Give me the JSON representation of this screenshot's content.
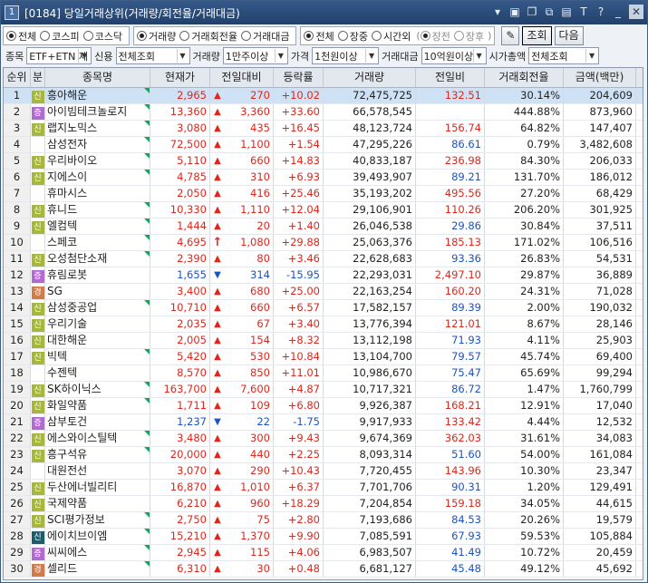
{
  "window": {
    "number": "1",
    "title": "[0184] 당일거래상위(거래량/회전율/거래대금)"
  },
  "titlebar_icons": [
    "menu-icon",
    "layout-icon",
    "copy-icon",
    "link-icon",
    "print-icon",
    "font-icon",
    "help-icon"
  ],
  "filters": {
    "market": {
      "options": [
        "전체",
        "코스피",
        "코스닥"
      ],
      "selected": 0
    },
    "sort": {
      "options": [
        "거래량",
        "거래회전율",
        "거래대금"
      ],
      "selected": 0
    },
    "session": {
      "options": [
        "전체",
        "장중",
        "시간외"
      ],
      "selected": 0
    },
    "session_sub": {
      "options": [
        "장전",
        "장후"
      ],
      "selected": 0
    },
    "query_btn": "조회",
    "next_btn": "다음",
    "stock_label": "종목",
    "stock_value": "ETF+ETN 제",
    "credit_label": "신용",
    "credit_value": "전체조회",
    "volume_label": "거래량",
    "volume_value": "1만주이상",
    "price_label": "가격",
    "price_value": "1천원이상",
    "amount_label": "거래대금",
    "amount_value": "10억원이상",
    "mcap_label": "시가총액",
    "mcap_value": "전체조회"
  },
  "columns": [
    "순위",
    "분",
    "종목명",
    "현재가",
    "전일대비",
    "등락률",
    "거래량",
    "전일비",
    "거래회전율",
    "금액(백만)"
  ],
  "colors": {
    "up": "#e0251b",
    "down": "#1a53c6",
    "accent": "#22406a"
  },
  "rows": [
    {
      "rank": "1",
      "badge": "신",
      "name": "흥아해운",
      "price": "2,965",
      "dir": "up",
      "change": "270",
      "rate": "+10.02",
      "volume": "72,475,725",
      "prev": "132.51",
      "turnover": "30.14%",
      "amount": "204,609"
    },
    {
      "rank": "2",
      "badge": "증",
      "name": "아이빔테크놀로지",
      "price": "13,360",
      "dir": "up",
      "change": "3,360",
      "rate": "+33.60",
      "volume": "66,578,545",
      "prev": "",
      "turnover": "444.88%",
      "amount": "873,960"
    },
    {
      "rank": "3",
      "badge": "신",
      "name": "랩지노믹스",
      "price": "3,080",
      "dir": "up",
      "change": "435",
      "rate": "+16.45",
      "volume": "48,123,724",
      "prev": "156.74",
      "turnover": "64.82%",
      "amount": "147,407"
    },
    {
      "rank": "4",
      "badge": "",
      "name": "삼성전자",
      "price": "72,500",
      "dir": "up",
      "change": "1,100",
      "rate": "+1.54",
      "volume": "47,295,226",
      "prev": "86.61",
      "turnover": "0.79%",
      "amount": "3,482,608"
    },
    {
      "rank": "5",
      "badge": "신",
      "name": "우리바이오",
      "price": "5,110",
      "dir": "up",
      "change": "660",
      "rate": "+14.83",
      "volume": "40,833,187",
      "prev": "236.98",
      "turnover": "84.30%",
      "amount": "206,033"
    },
    {
      "rank": "6",
      "badge": "신",
      "name": "지에스이",
      "price": "4,785",
      "dir": "up",
      "change": "310",
      "rate": "+6.93",
      "volume": "39,493,907",
      "prev": "89.21",
      "turnover": "131.70%",
      "amount": "186,012"
    },
    {
      "rank": "7",
      "badge": "",
      "name": "휴마시스",
      "price": "2,050",
      "dir": "up",
      "change": "416",
      "rate": "+25.46",
      "volume": "35,193,202",
      "prev": "495.56",
      "turnover": "27.20%",
      "amount": "68,429"
    },
    {
      "rank": "8",
      "badge": "신",
      "name": "휴니드",
      "price": "10,330",
      "dir": "up",
      "change": "1,110",
      "rate": "+12.04",
      "volume": "29,106,901",
      "prev": "110.26",
      "turnover": "206.20%",
      "amount": "301,925"
    },
    {
      "rank": "9",
      "badge": "신",
      "name": "엘컴텍",
      "price": "1,444",
      "dir": "up",
      "change": "20",
      "rate": "+1.40",
      "volume": "26,046,538",
      "prev": "29.86",
      "turnover": "30.84%",
      "amount": "37,511"
    },
    {
      "rank": "10",
      "badge": "",
      "name": "스페코",
      "price": "4,695",
      "dir": "limit",
      "change": "1,080",
      "rate": "+29.88",
      "volume": "25,063,376",
      "prev": "185.13",
      "turnover": "171.02%",
      "amount": "106,516"
    },
    {
      "rank": "11",
      "badge": "신",
      "name": "오성첨단소재",
      "price": "2,390",
      "dir": "up",
      "change": "80",
      "rate": "+3.46",
      "volume": "22,628,683",
      "prev": "93.36",
      "turnover": "26.83%",
      "amount": "54,531"
    },
    {
      "rank": "12",
      "badge": "증",
      "name": "휴림로봇",
      "price": "1,655",
      "dir": "down",
      "change": "314",
      "rate": "-15.95",
      "volume": "22,293,031",
      "prev": "2,497.10",
      "turnover": "29.87%",
      "amount": "36,889"
    },
    {
      "rank": "13",
      "badge": "경",
      "name": "SG",
      "price": "3,400",
      "dir": "up",
      "change": "680",
      "rate": "+25.00",
      "volume": "22,163,254",
      "prev": "160.20",
      "turnover": "24.31%",
      "amount": "71,028"
    },
    {
      "rank": "14",
      "badge": "신",
      "name": "삼성중공업",
      "price": "10,710",
      "dir": "up",
      "change": "660",
      "rate": "+6.57",
      "volume": "17,582,157",
      "prev": "89.39",
      "turnover": "2.00%",
      "amount": "190,032"
    },
    {
      "rank": "15",
      "badge": "신",
      "name": "우리기술",
      "price": "2,035",
      "dir": "up",
      "change": "67",
      "rate": "+3.40",
      "volume": "13,776,394",
      "prev": "121.01",
      "turnover": "8.67%",
      "amount": "28,146"
    },
    {
      "rank": "16",
      "badge": "신",
      "name": "대한해운",
      "price": "2,005",
      "dir": "up",
      "change": "154",
      "rate": "+8.32",
      "volume": "13,112,198",
      "prev": "71.93",
      "turnover": "4.11%",
      "amount": "25,903"
    },
    {
      "rank": "17",
      "badge": "신",
      "name": "빅텍",
      "price": "5,420",
      "dir": "up",
      "change": "530",
      "rate": "+10.84",
      "volume": "13,104,700",
      "prev": "79.57",
      "turnover": "45.74%",
      "amount": "69,400"
    },
    {
      "rank": "18",
      "badge": "",
      "name": "수젠텍",
      "price": "8,570",
      "dir": "up",
      "change": "850",
      "rate": "+11.01",
      "volume": "10,986,670",
      "prev": "75.47",
      "turnover": "65.69%",
      "amount": "99,294"
    },
    {
      "rank": "19",
      "badge": "신",
      "name": "SK하이닉스",
      "price": "163,700",
      "dir": "up",
      "change": "7,600",
      "rate": "+4.87",
      "volume": "10,717,321",
      "prev": "86.72",
      "turnover": "1.47%",
      "amount": "1,760,799"
    },
    {
      "rank": "20",
      "badge": "신",
      "name": "화일약품",
      "price": "1,711",
      "dir": "up",
      "change": "109",
      "rate": "+6.80",
      "volume": "9,926,387",
      "prev": "168.21",
      "turnover": "12.91%",
      "amount": "17,040"
    },
    {
      "rank": "21",
      "badge": "증",
      "name": "삼부토건",
      "price": "1,237",
      "dir": "down",
      "change": "22",
      "rate": "-1.75",
      "volume": "9,917,933",
      "prev": "133.42",
      "turnover": "4.44%",
      "amount": "12,532"
    },
    {
      "rank": "22",
      "badge": "신",
      "name": "에스와이스틸텍",
      "price": "3,480",
      "dir": "up",
      "change": "300",
      "rate": "+9.43",
      "volume": "9,674,369",
      "prev": "362.03",
      "turnover": "31.61%",
      "amount": "34,083"
    },
    {
      "rank": "23",
      "badge": "신",
      "name": "흥구석유",
      "price": "20,000",
      "dir": "up",
      "change": "440",
      "rate": "+2.25",
      "volume": "8,093,314",
      "prev": "51.60",
      "turnover": "54.00%",
      "amount": "161,084"
    },
    {
      "rank": "24",
      "badge": "",
      "name": "대원전선",
      "price": "3,070",
      "dir": "up",
      "change": "290",
      "rate": "+10.43",
      "volume": "7,720,455",
      "prev": "143.96",
      "turnover": "10.30%",
      "amount": "23,347"
    },
    {
      "rank": "25",
      "badge": "신",
      "name": "두산에너빌리티",
      "price": "16,870",
      "dir": "up",
      "change": "1,010",
      "rate": "+6.37",
      "volume": "7,701,706",
      "prev": "90.31",
      "turnover": "1.20%",
      "amount": "129,491"
    },
    {
      "rank": "26",
      "badge": "신",
      "name": "국제약품",
      "price": "6,210",
      "dir": "up",
      "change": "960",
      "rate": "+18.29",
      "volume": "7,204,854",
      "prev": "159.18",
      "turnover": "34.05%",
      "amount": "44,615"
    },
    {
      "rank": "27",
      "badge": "신",
      "name": "SCI평가정보",
      "price": "2,750",
      "dir": "up",
      "change": "75",
      "rate": "+2.80",
      "volume": "7,193,686",
      "prev": "84.53",
      "turnover": "20.26%",
      "amount": "19,579"
    },
    {
      "rank": "28",
      "badge": "신d",
      "name": "에이치브이엠",
      "price": "15,210",
      "dir": "up",
      "change": "1,370",
      "rate": "+9.90",
      "volume": "7,085,591",
      "prev": "67.93",
      "turnover": "59.53%",
      "amount": "105,884"
    },
    {
      "rank": "29",
      "badge": "증",
      "name": "씨씨에스",
      "price": "2,945",
      "dir": "up",
      "change": "115",
      "rate": "+4.06",
      "volume": "6,983,507",
      "prev": "41.49",
      "turnover": "10.72%",
      "amount": "20,459"
    },
    {
      "rank": "30",
      "badge": "경",
      "name": "셀리드",
      "price": "6,310",
      "dir": "up",
      "change": "30",
      "rate": "+0.48",
      "volume": "6,681,127",
      "prev": "45.48",
      "turnover": "49.12%",
      "amount": "45,692"
    }
  ]
}
